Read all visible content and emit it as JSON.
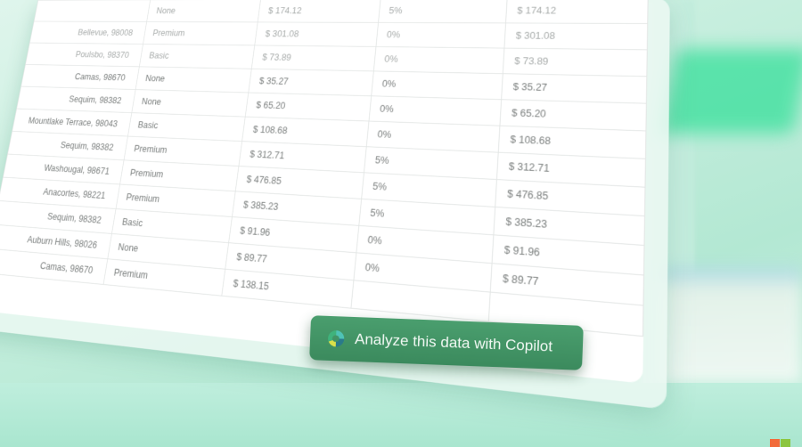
{
  "table": {
    "rows": [
      {
        "city": "",
        "tier": "None",
        "amount": "$ 174.12",
        "discount": "5%",
        "total": "$ 174.12"
      },
      {
        "city": "Bellevue, 98008",
        "tier": "Premium",
        "amount": "$ 301.08",
        "discount": "0%",
        "total": "$ 301.08"
      },
      {
        "city": "Poulsbo, 98370",
        "tier": "Basic",
        "amount": "$ 73.89",
        "discount": "0%",
        "total": "$ 73.89"
      },
      {
        "city": "Camas, 98670",
        "tier": "None",
        "amount": "$ 35.27",
        "discount": "0%",
        "total": "$ 35.27"
      },
      {
        "city": "Sequim, 98382",
        "tier": "None",
        "amount": "$ 65.20",
        "discount": "0%",
        "total": "$ 65.20"
      },
      {
        "city": "Mountlake Terrace, 98043",
        "tier": "Basic",
        "amount": "$ 108.68",
        "discount": "0%",
        "total": "$ 108.68"
      },
      {
        "city": "Sequim, 98382",
        "tier": "Premium",
        "amount": "$ 312.71",
        "discount": "5%",
        "total": "$ 312.71"
      },
      {
        "city": "Washougal, 98671",
        "tier": "Premium",
        "amount": "$ 476.85",
        "discount": "5%",
        "total": "$ 476.85"
      },
      {
        "city": "Anacortes, 98221",
        "tier": "Premium",
        "amount": "$ 385.23",
        "discount": "5%",
        "total": "$ 385.23"
      },
      {
        "city": "Sequim, 98382",
        "tier": "Basic",
        "amount": "$ 91.96",
        "discount": "0%",
        "total": "$ 91.96"
      },
      {
        "city": "Auburn Hills, 98026",
        "tier": "None",
        "amount": "$ 89.77",
        "discount": "0%",
        "total": "$ 89.77"
      },
      {
        "city": "Camas, 98670",
        "tier": "Premium",
        "amount": "$ 138.15",
        "discount": "",
        "total": ""
      }
    ]
  },
  "copilot_button": {
    "label": "Analyze this data with Copilot",
    "icon": "copilot-icon",
    "color": "#3f9163"
  },
  "brand": {
    "logo": "microsoft-logo",
    "colors": [
      "#f25022",
      "#7fba00"
    ]
  }
}
